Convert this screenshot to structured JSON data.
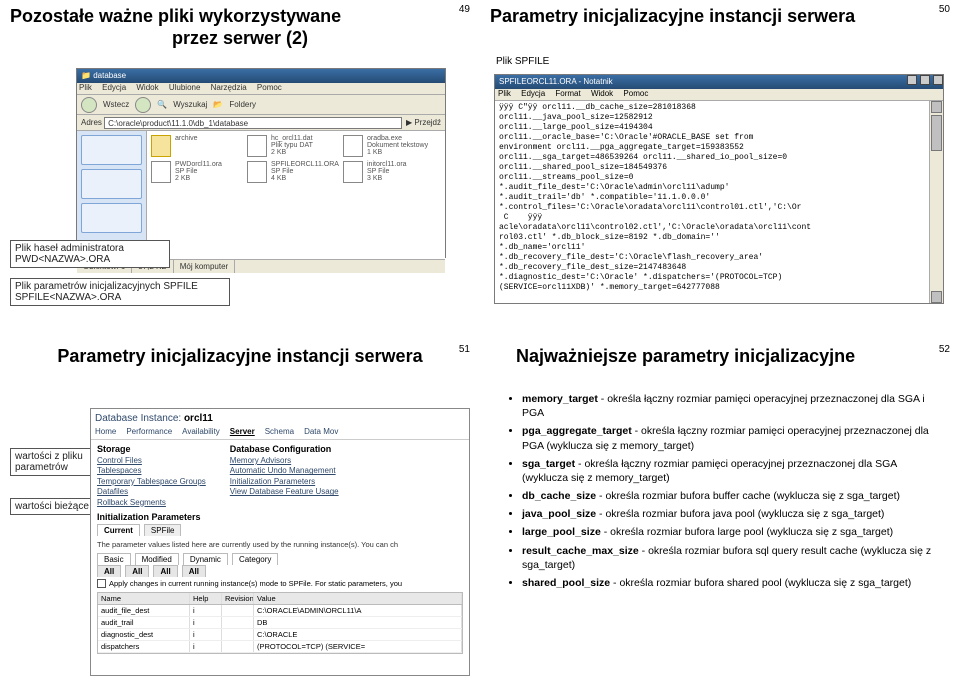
{
  "slides": {
    "s49": {
      "num": "49",
      "title_l1": "Pozostałe ważne pliki wykorzystywane",
      "title_l2": "przez serwer (2)",
      "callout1_l1": "Plik haseł administratora",
      "callout1_l2": "PWD<NAZWA>.ORA",
      "callout2_l1": "Plik parametrów inicjalizacyjnych SPFILE",
      "callout2_l2": "SPFILE<NAZWA>.ORA",
      "explorer": {
        "title": "database",
        "menu": [
          "Plik",
          "Edycja",
          "Widok",
          "Ulubione",
          "Narzędzia",
          "Pomoc"
        ],
        "nav": [
          "Wstecz",
          "",
          "Wyszukaj",
          "Foldery"
        ],
        "addr_label": "Adres",
        "address": "C:\\oracle\\product\\11.1.0\\db_1\\database",
        "go": "Przejdź",
        "files": [
          {
            "name": "archive",
            "sub": "",
            "folder": true
          },
          {
            "name": "hc_orcl11.dat",
            "sub": "Plik typu DAT\n2 KB",
            "folder": false
          },
          {
            "name": "oradba.exe",
            "sub": "Dokument tekstowy\n1 KB",
            "folder": false
          },
          {
            "name": "PWDorcl11.ora",
            "sub": "SP File\n2 KB",
            "folder": false
          },
          {
            "name": "SPFILEORCL11.ORA",
            "sub": "SP File\n4 KB",
            "folder": false
          },
          {
            "name": "initorcl11.ora",
            "sub": "SP File\n3 KB",
            "folder": false
          }
        ],
        "status": [
          "Obiektów: 6",
          "37,2 KB",
          "Mój komputer"
        ]
      }
    },
    "s50": {
      "num": "50",
      "title": "Parametry inicjalizacyjne instancji serwera",
      "spfile_label": "Plik SPFILE",
      "win_title": "SPFILEORCL11.ORA - Notatnik",
      "menu": [
        "Plik",
        "Edycja",
        "Format",
        "Widok",
        "Pomoc"
      ],
      "body": "ÿÿÿ C\"ÿÿ orcl11.__db_cache_size=281018368 \norcl11.__java_pool_size=12582912 \norcl11.__large_pool_size=4194304 \norcl11.__oracle_base='C:\\Oracle'#ORACLE_BASE set from\nenvironment orcl11.__pga_aggregate_target=159383552 \norcl11.__sga_target=486539264 orcl11.__shared_io_pool_size=0 \norcl11.__shared_pool_size=184549376 \norcl11.__streams_pool_size=0 \n*.audit_file_dest='C:\\Oracle\\admin\\orcl11\\adump' \n*.audit_trail='db' *.compatible='11.1.0.0.0' \n*.control_files='C:\\Oracle\\oradata\\orcl11\\control01.ctl','C:\\Or \n C    ÿÿÿ \nacle\\oradata\\orcl11\\control02.ctl','C:\\Oracle\\oradata\\orcl11\\cont\nrol03.ctl' *.db_block_size=8192 *.db_domain='' \n*.db_name='orcl11' \n*.db_recovery_file_dest='C:\\Oracle\\flash_recovery_area' \n*.db_recovery_file_dest_size=2147483648 \n*.diagnostic_dest='C:\\Oracle' *.dispatchers='(PROTOCOL=TCP)\n(SERVICE=orcl11XDB)' *.memory_target=642777088 "
    },
    "s51": {
      "num": "51",
      "title": "Parametry inicjalizacyjne instancji serwera",
      "callout1": "wartości z pliku parametrów",
      "callout2": "wartości bieżące",
      "crumb_prefix": "Database Instance: ",
      "crumb_val": "orcl11",
      "tabs": [
        "Home",
        "Performance",
        "Availability",
        "Server",
        "Schema",
        "Data Mov"
      ],
      "tab_sel": "Server",
      "col1_h": "Storage",
      "col1": [
        "Control Files",
        "Tablespaces",
        "Temporary Tablespace Groups",
        "Datafiles",
        "Rollback Segments"
      ],
      "col2_h": "Database Configuration",
      "col2": [
        "Memory Advisors",
        "Automatic Undo Management",
        "Initialization Parameters",
        "View Database Feature Usage"
      ],
      "section": "Initialization Parameters",
      "subtabs": [
        "Current",
        "SPFile"
      ],
      "subtab_sel": "Current",
      "note": "The parameter values listed here are currently used by the running instance(s). You can ch",
      "cats": [
        "Basic",
        "Modified",
        "Dynamic",
        "Category"
      ],
      "cat_sel": "All",
      "cb_prefix": "",
      "cb_label": "Apply changes in current running instance(s) mode to SPFile. For static parameters, you",
      "tbl_hdr": [
        "Name",
        "Help",
        "Revisions",
        "Value"
      ],
      "rows": [
        {
          "n": "audit_file_dest",
          "h": "i",
          "r": "",
          "v": "C:\\ORACLE\\ADMIN\\ORCL11\\A"
        },
        {
          "n": "audit_trail",
          "h": "i",
          "r": "",
          "v": "DB"
        },
        {
          "n": "diagnostic_dest",
          "h": "i",
          "r": "",
          "v": "C:\\ORACLE"
        },
        {
          "n": "dispatchers",
          "h": "i",
          "r": "",
          "v": "(PROTOCOL=TCP) (SERVICE="
        }
      ],
      "cat_all": "All"
    },
    "s52": {
      "num": "52",
      "title": "Najważniejsze parametry inicjalizacyjne",
      "items": [
        {
          "b": "memory_target",
          "t": " - określa łączny rozmiar pamięci operacyjnej przeznaczonej dla SGA i PGA"
        },
        {
          "b": "pga_aggregate_target",
          "t": " - określa łączny rozmiar pamięci operacyjnej przeznaczonej dla PGA (wyklucza się z memory_target)"
        },
        {
          "b": "sga_target",
          "t": " - określa łączny rozmiar pamięci operacyjnej przeznaczonej dla SGA (wyklucza się z memory_target)"
        },
        {
          "b": "db_cache_size",
          "t": " - określa rozmiar bufora buffer cache (wyklucza się z sga_target)"
        },
        {
          "b": "java_pool_size",
          "t": " - określa rozmiar bufora java pool (wyklucza się z sga_target)"
        },
        {
          "b": "large_pool_size",
          "t": " - określa rozmiar bufora large pool (wyklucza się z sga_target)"
        },
        {
          "b": "result_cache_max_size",
          "t": "  - określa rozmiar bufora sql query result cache (wyklucza się z sga_target)"
        },
        {
          "b": "shared_pool_size",
          "t": " - określa rozmiar bufora shared pool (wyklucza się z sga_target)"
        }
      ]
    }
  }
}
